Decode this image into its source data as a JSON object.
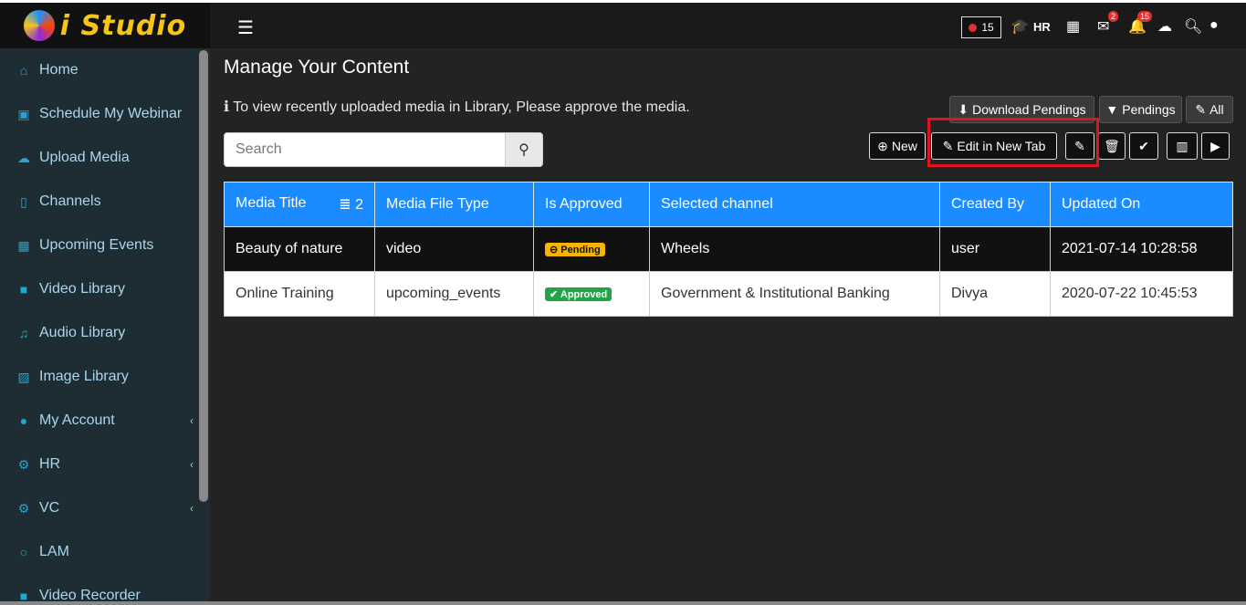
{
  "brand": {
    "name": "i Studio"
  },
  "sidebar": {
    "items": [
      {
        "label": "Home",
        "icon": "home-icon",
        "glyph": "⌂"
      },
      {
        "label": "Schedule My Webinar",
        "icon": "calendar-plus-icon",
        "glyph": "▣"
      },
      {
        "label": "Upload Media",
        "icon": "cloud-upload-icon",
        "glyph": "☁"
      },
      {
        "label": "Channels",
        "icon": "bookmark-icon",
        "glyph": "▯"
      },
      {
        "label": "Upcoming Events",
        "icon": "calendar-icon",
        "glyph": "▦"
      },
      {
        "label": "Video Library",
        "icon": "video-icon",
        "glyph": "■"
      },
      {
        "label": "Audio Library",
        "icon": "music-icon",
        "glyph": "♫"
      },
      {
        "label": "Image Library",
        "icon": "image-icon",
        "glyph": "▨"
      },
      {
        "label": "My Account",
        "icon": "user-icon",
        "glyph": "●"
      },
      {
        "label": "HR",
        "icon": "cogs-icon",
        "glyph": "⚙"
      },
      {
        "label": "VC",
        "icon": "cogs-icon",
        "glyph": "⚙"
      },
      {
        "label": "LAM",
        "icon": "circle-icon",
        "glyph": "○"
      },
      {
        "label": "Video Recorder",
        "icon": "video-icon",
        "glyph": "■"
      }
    ]
  },
  "topbar": {
    "counter": "15",
    "hr_label": "HR",
    "messages_badge": "2",
    "notifications_badge": "15"
  },
  "main": {
    "title": "Manage Your Content",
    "info": "To view recently uploaded media in Library, Please approve the media.",
    "search_placeholder": "Search",
    "buttons": {
      "download_pendings": "Download Pendings",
      "pendings": "Pendings",
      "all": "All",
      "new": "New",
      "edit_new_tab": "Edit in New Tab"
    }
  },
  "table": {
    "count": "2",
    "headers": [
      "Media Title",
      "Media File Type",
      "Is Approved",
      "Selected channel",
      "Created By",
      "Updated On"
    ],
    "rows": [
      {
        "title": "Beauty of nature",
        "type": "video",
        "status": "Pending",
        "channel": "Wheels",
        "created_by": "user",
        "updated": "2021-07-14 10:28:58"
      },
      {
        "title": "Online Training",
        "type": "upcoming_events",
        "status": "Approved",
        "channel": "Government & Institutional Banking",
        "created_by": "Divya",
        "updated": "2020-07-22 10:45:53"
      }
    ]
  },
  "colors": {
    "accent": "#1a8cff",
    "pending": "#f7b500",
    "approved": "#23a547",
    "highlight": "#e0141e"
  }
}
